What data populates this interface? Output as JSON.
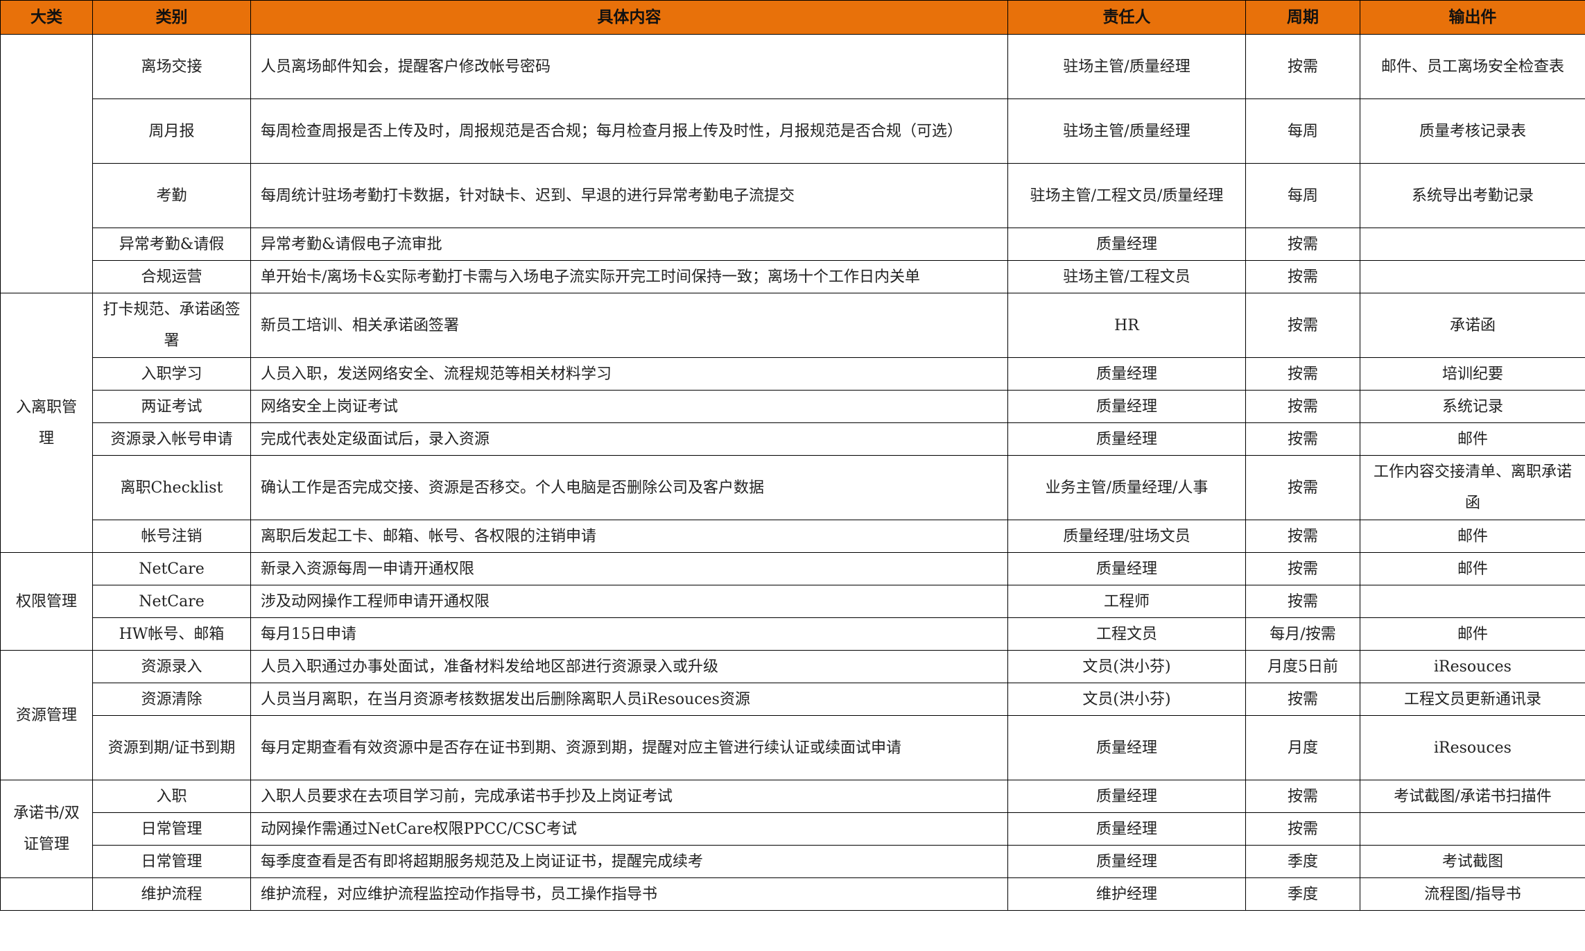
{
  "table": {
    "headers": [
      "大类",
      "类别",
      "具体内容",
      "责任人",
      "周期",
      "输出件"
    ],
    "sections": [
      {
        "category": "",
        "rows": [
          {
            "sub": "离场交接",
            "content": "人员离场邮件知会，提醒客户修改帐号密码",
            "resp": "驻场主管/质量经理",
            "cycle": "按需",
            "output": "邮件、员工离场安全检查表"
          },
          {
            "sub": "周月报",
            "content": "每周检查周报是否上传及时，周报规范是否合规；每月检查月报上传及时性，月报规范是否合规（可选）",
            "resp": "驻场主管/质量经理",
            "cycle": "每周",
            "output": "质量考核记录表"
          },
          {
            "sub": "考勤",
            "content": "每周统计驻场考勤打卡数据，针对缺卡、迟到、早退的进行异常考勤电子流提交",
            "resp": "驻场主管/工程文员/质量经理",
            "cycle": "每周",
            "output": "系统导出考勤记录"
          },
          {
            "sub": "异常考勤&请假",
            "content": "异常考勤&请假电子流审批",
            "resp": "质量经理",
            "cycle": "按需",
            "output": ""
          },
          {
            "sub": "合规运营",
            "content": "单开始卡/离场卡&实际考勤打卡需与入场电子流实际开完工时间保持一致；离场十个工作日内关单",
            "resp": "驻场主管/工程文员",
            "cycle": "按需",
            "output": ""
          }
        ]
      },
      {
        "category": "入离职管理",
        "rows": [
          {
            "sub": "打卡规范、承诺函签署",
            "content": "新员工培训、相关承诺函签署",
            "resp": "HR",
            "cycle": "按需",
            "output": "承诺函"
          },
          {
            "sub": "入职学习",
            "content": "人员入职，发送网络安全、流程规范等相关材料学习",
            "resp": "质量经理",
            "cycle": "按需",
            "output": "培训纪要"
          },
          {
            "sub": "两证考试",
            "content": "网络安全上岗证考试",
            "resp": "质量经理",
            "cycle": "按需",
            "output": "系统记录"
          },
          {
            "sub": "资源录入帐号申请",
            "content": "完成代表处定级面试后，录入资源",
            "resp": "质量经理",
            "cycle": "按需",
            "output": "邮件"
          },
          {
            "sub": "离职Checklist",
            "content": "确认工作是否完成交接、资源是否移交。个人电脑是否删除公司及客户数据",
            "resp": "业务主管/质量经理/人事",
            "cycle": "按需",
            "output": "工作内容交接清单、离职承诺函"
          },
          {
            "sub": "帐号注销",
            "content": "离职后发起工卡、邮箱、帐号、各权限的注销申请",
            "resp": "质量经理/驻场文员",
            "cycle": "按需",
            "output": "邮件"
          }
        ]
      },
      {
        "category": "权限管理",
        "rows": [
          {
            "sub": "NetCare",
            "content": "新录入资源每周一申请开通权限",
            "resp": "质量经理",
            "cycle": "按需",
            "output": "邮件"
          },
          {
            "sub": "NetCare",
            "content": "涉及动网操作工程师申请开通权限",
            "resp": "工程师",
            "cycle": "按需",
            "output": ""
          },
          {
            "sub": "HW帐号、邮箱",
            "content": "每月15日申请",
            "resp": "工程文员",
            "cycle": "每月/按需",
            "output": "邮件"
          }
        ]
      },
      {
        "category": "资源管理",
        "rows": [
          {
            "sub": "资源录入",
            "content": "人员入职通过办事处面试，准备材料发给地区部进行资源录入或升级",
            "resp": "文员(洪小芬)",
            "cycle": "月度5日前",
            "output": "iResouces"
          },
          {
            "sub": "资源清除",
            "content": "人员当月离职，在当月资源考核数据发出后删除离职人员iResouces资源",
            "resp": "文员(洪小芬)",
            "cycle": "按需",
            "output": "工程文员更新通讯录"
          },
          {
            "sub": "资源到期/证书到期",
            "content": "每月定期查看有效资源中是否存在证书到期、资源到期，提醒对应主管进行续认证或续面试申请",
            "resp": "质量经理",
            "cycle": "月度",
            "output": "iResouces"
          }
        ]
      },
      {
        "category": "承诺书/双证管理",
        "rows": [
          {
            "sub": "入职",
            "content": "入职人员要求在去项目学习前，完成承诺书手抄及上岗证考试",
            "resp": "质量经理",
            "cycle": "按需",
            "output": "考试截图/承诺书扫描件"
          },
          {
            "sub": "日常管理",
            "content": "动网操作需通过NetCare权限PPCC/CSC考试",
            "resp": "质量经理",
            "cycle": "按需",
            "output": ""
          },
          {
            "sub": "日常管理",
            "content": "每季度查看是否有即将超期服务规范及上岗证证书，提醒完成续考",
            "resp": "质量经理",
            "cycle": "季度",
            "output": "考试截图"
          }
        ]
      },
      {
        "category": "",
        "rows": [
          {
            "sub": "维护流程",
            "content": "维护流程，对应维护流程监控动作指导书，员工操作指导书",
            "resp": "维护经理",
            "cycle": "季度",
            "output": "流程图/指导书"
          }
        ]
      }
    ]
  }
}
